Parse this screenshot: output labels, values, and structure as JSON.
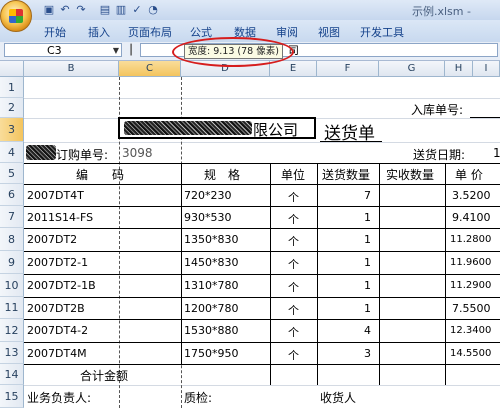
{
  "window": {
    "filename": "示例.xlsm -"
  },
  "quick_access": [
    "save-icon",
    "undo-icon",
    "redo-icon",
    "print-icon",
    "preview-icon",
    "spell-icon",
    "chart-icon"
  ],
  "ribbon": {
    "tabs": [
      "开始",
      "插入",
      "页面布局",
      "公式",
      "数据",
      "审阅",
      "视图",
      "开发工具"
    ]
  },
  "formula_bar": {
    "name_box": "C3",
    "content_fragment": "司"
  },
  "tooltip": {
    "text": "宽度: 9.13 (78 像素)"
  },
  "columns": [
    "B",
    "C",
    "D",
    "E",
    "F",
    "G",
    "H",
    "I"
  ],
  "rows": [
    "1",
    "2",
    "3",
    "4",
    "5",
    "6",
    "7",
    "8",
    "9",
    "10",
    "11",
    "12",
    "13",
    "14",
    "15"
  ],
  "sheet": {
    "label_ruku": "入库单号:",
    "company_suffix": "限公司",
    "title": "送货单",
    "label_order": "订购单号:",
    "order_no": "3098",
    "label_delivery_date": "送货日期:",
    "date_fragment": "1",
    "headers": {
      "code": "编　　码",
      "spec": "规　格",
      "unit": "单位",
      "qty_sent": "送货数量",
      "qty_received": "实收数量",
      "price": "单 价"
    },
    "items": [
      {
        "code": "2007DT4T",
        "spec": "720*230",
        "unit": "个",
        "qty": "7",
        "price": "3.5200"
      },
      {
        "code": "2011S14-FS",
        "spec": "930*530",
        "unit": "个",
        "qty": "1",
        "price": "9.4100"
      },
      {
        "code": "2007DT2",
        "spec": "1350*830",
        "unit": "个",
        "qty": "1",
        "price": "11.2800"
      },
      {
        "code": "2007DT2-1",
        "spec": "1450*830",
        "unit": "个",
        "qty": "1",
        "price": "11.9600"
      },
      {
        "code": "2007DT2-1B",
        "spec": "1310*780",
        "unit": "个",
        "qty": "1",
        "price": "11.2900"
      },
      {
        "code": "2007DT2B",
        "spec": "1200*780",
        "unit": "个",
        "qty": "1",
        "price": "7.5500"
      },
      {
        "code": "2007DT4-2",
        "spec": "1530*880",
        "unit": "个",
        "qty": "4",
        "price": "12.3400"
      },
      {
        "code": "2007DT4M",
        "spec": "1750*950",
        "unit": "个",
        "qty": "3",
        "price": "14.5500"
      }
    ],
    "total_label": "合计金额",
    "footer_sales": "业务负责人:",
    "footer_qc": "质检:",
    "footer_receiver": "收货人"
  }
}
